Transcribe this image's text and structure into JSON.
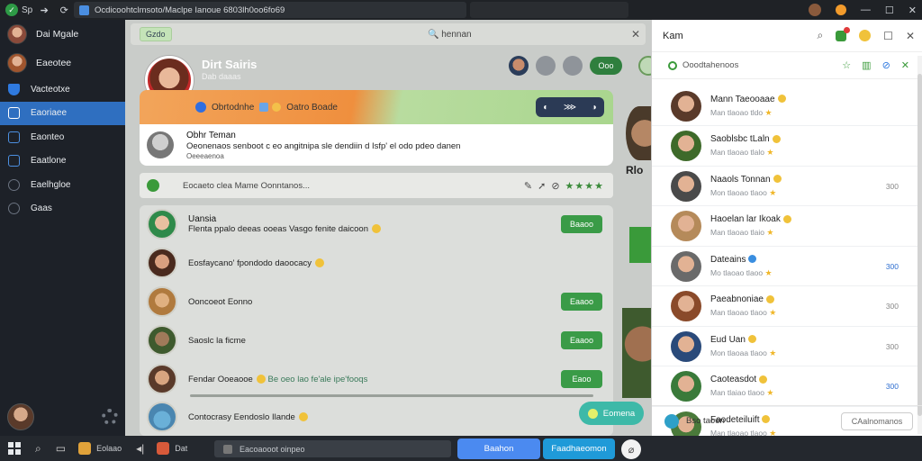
{
  "browser": {
    "tab_label": "Sp",
    "address": "Ocdicoohtclmsoto/Maclpe Ianoue 6803lh0oo6fo69",
    "icons": [
      "app-logo-icon",
      "back-icon",
      "reload-icon",
      "shield-icon",
      "minimize-icon",
      "maximize-icon",
      "close-icon"
    ]
  },
  "sidebar": {
    "user": [
      {
        "name": "Dai Mgale",
        "color": "#8a4a3a"
      },
      {
        "name": "Eaeotee",
        "color": "#a0552e"
      }
    ],
    "items": [
      {
        "label": "Vacteotxe",
        "icon": "shield-icon",
        "active": false
      },
      {
        "label": "Eaoriaee",
        "icon": "chat-icon",
        "active": true
      },
      {
        "label": "Eaonteo",
        "icon": "contacts-icon",
        "active": false
      },
      {
        "label": "Eaatlone",
        "icon": "bookmark-icon",
        "active": false
      },
      {
        "label": "Eaelhgloe",
        "icon": "moon-icon",
        "active": false
      },
      {
        "label": "Gaas",
        "icon": "leaf-icon",
        "active": false
      }
    ]
  },
  "main": {
    "top_chip": "Gzdo",
    "search_label": "hennan",
    "hero": {
      "name": "Dirt Sairis",
      "sub": "Dab daaas",
      "button": "Ooo"
    },
    "banner": {
      "left": "Obrtodnhe",
      "right": "Oatro Boade"
    },
    "card": {
      "name": "Obhr Teman",
      "message": "Oeonenaos senboot c eo angitnipa sle dendiin d Isfp' el odo pdeo danen",
      "sub": "Oeeeaenoa"
    },
    "compose": {
      "placeholder": "Eocaeto clea Mame Oonntanos..."
    },
    "list": [
      {
        "title": "Uansia",
        "text": "Flenta ppalo deeas ooeas Vasgo fenite daicoon",
        "button": "Baaoo",
        "color": "#2f8a4a"
      },
      {
        "title": "",
        "text": "Eosfaycano' fpondodo daoocacy",
        "button": "",
        "color": "#9a5a3a"
      },
      {
        "title": "",
        "text": "Ooncoeot Eonno",
        "button": "Eaaoo",
        "color": "#b07a3e"
      },
      {
        "title": "",
        "text": "Saoslc la ficme",
        "button": "Eaaoo",
        "color": "#6a5a3a"
      },
      {
        "title": "",
        "text": "Fendar Ooeaooe",
        "extra": "Be oeo lao fe'ale ipe'fooqs",
        "button": "Eaoo",
        "color": "#8e5840"
      },
      {
        "title": "",
        "text": "Contocrasy Eendoslo Ilande",
        "button": "",
        "color": "#4a86b0"
      }
    ],
    "fab": "Eomena",
    "side_text": "Rlo"
  },
  "right": {
    "title": "Kam",
    "search": "Ooodtahenoos",
    "contacts": [
      {
        "name": "Mann Taeooaae",
        "sub": "Man tlaoao tldo",
        "time": "",
        "color": "#5a3a2a"
      },
      {
        "name": "Saoblsbc tLaln",
        "sub": "Man tlaoao tlalo",
        "time": "",
        "color": "#3e6a2a"
      },
      {
        "name": "Naaols Tonnan",
        "sub": "Mon tlaoao tlaoo",
        "time": "300",
        "color": "#4a4a4a"
      },
      {
        "name": "Haoelan lar Ikoak",
        "sub": "Man tlaoao tlaio",
        "time": "",
        "color": "#b58a5a"
      },
      {
        "name": "Dateains",
        "sub": "Mo tlaoao tlaoo",
        "time": "300",
        "color": "#6a6a6a"
      },
      {
        "name": "Paeabnoniae",
        "sub": "Man tlaoao tlaoo",
        "time": "300",
        "color": "#8a4a2a"
      },
      {
        "name": "Eud Uan",
        "sub": "Mon tlaoaa tlaoo",
        "time": "300",
        "color": "#2a4a7a"
      },
      {
        "name": "Caoteasdot",
        "sub": "Man tlaiao tlaoo",
        "time": "300",
        "color": "#3a7a3a"
      },
      {
        "name": "Faodeteiluift",
        "sub": "Man tlaoao tlaoo",
        "time": "",
        "color": "#4a7a3a"
      }
    ],
    "footer_label": "Bso taoen",
    "footer_button": "CAalnomanos"
  },
  "taskbar": {
    "app1": "Eolaao",
    "app2": "Dat",
    "input": "Eacoaooot oinpeo",
    "button1": "Baahon",
    "button2": "Faadhaeomon"
  }
}
